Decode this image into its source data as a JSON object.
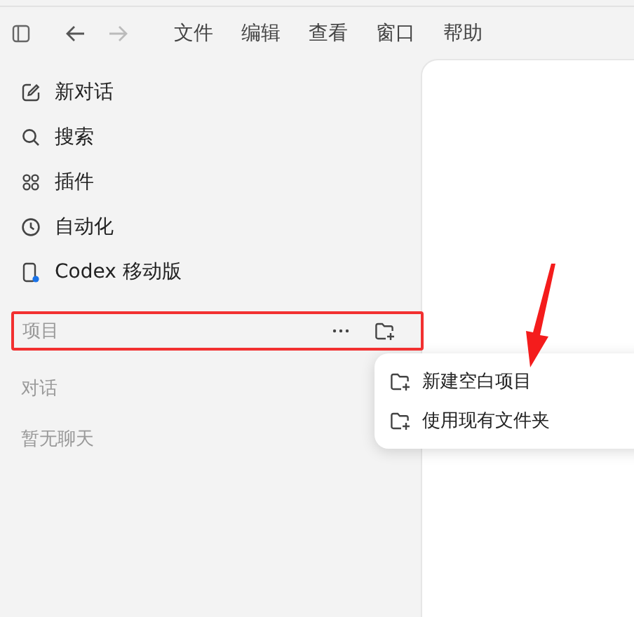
{
  "toolbar": {
    "menus": [
      "文件",
      "编辑",
      "查看",
      "窗口",
      "帮助"
    ]
  },
  "sidebar": {
    "items": [
      {
        "kind": "compose",
        "label": "新对话"
      },
      {
        "kind": "search",
        "label": "搜索"
      },
      {
        "kind": "plugins",
        "label": "插件"
      },
      {
        "kind": "clock",
        "label": "自动化"
      },
      {
        "kind": "mobile",
        "label": "Codex 移动版"
      }
    ]
  },
  "projects": {
    "label": "项目",
    "highlighted": true
  },
  "project_menu": {
    "items": [
      {
        "label": "新建空白项目"
      },
      {
        "label": "使用现有文件夹"
      }
    ]
  },
  "conversations": {
    "label": "对话",
    "empty_text": "暂无聊天"
  }
}
